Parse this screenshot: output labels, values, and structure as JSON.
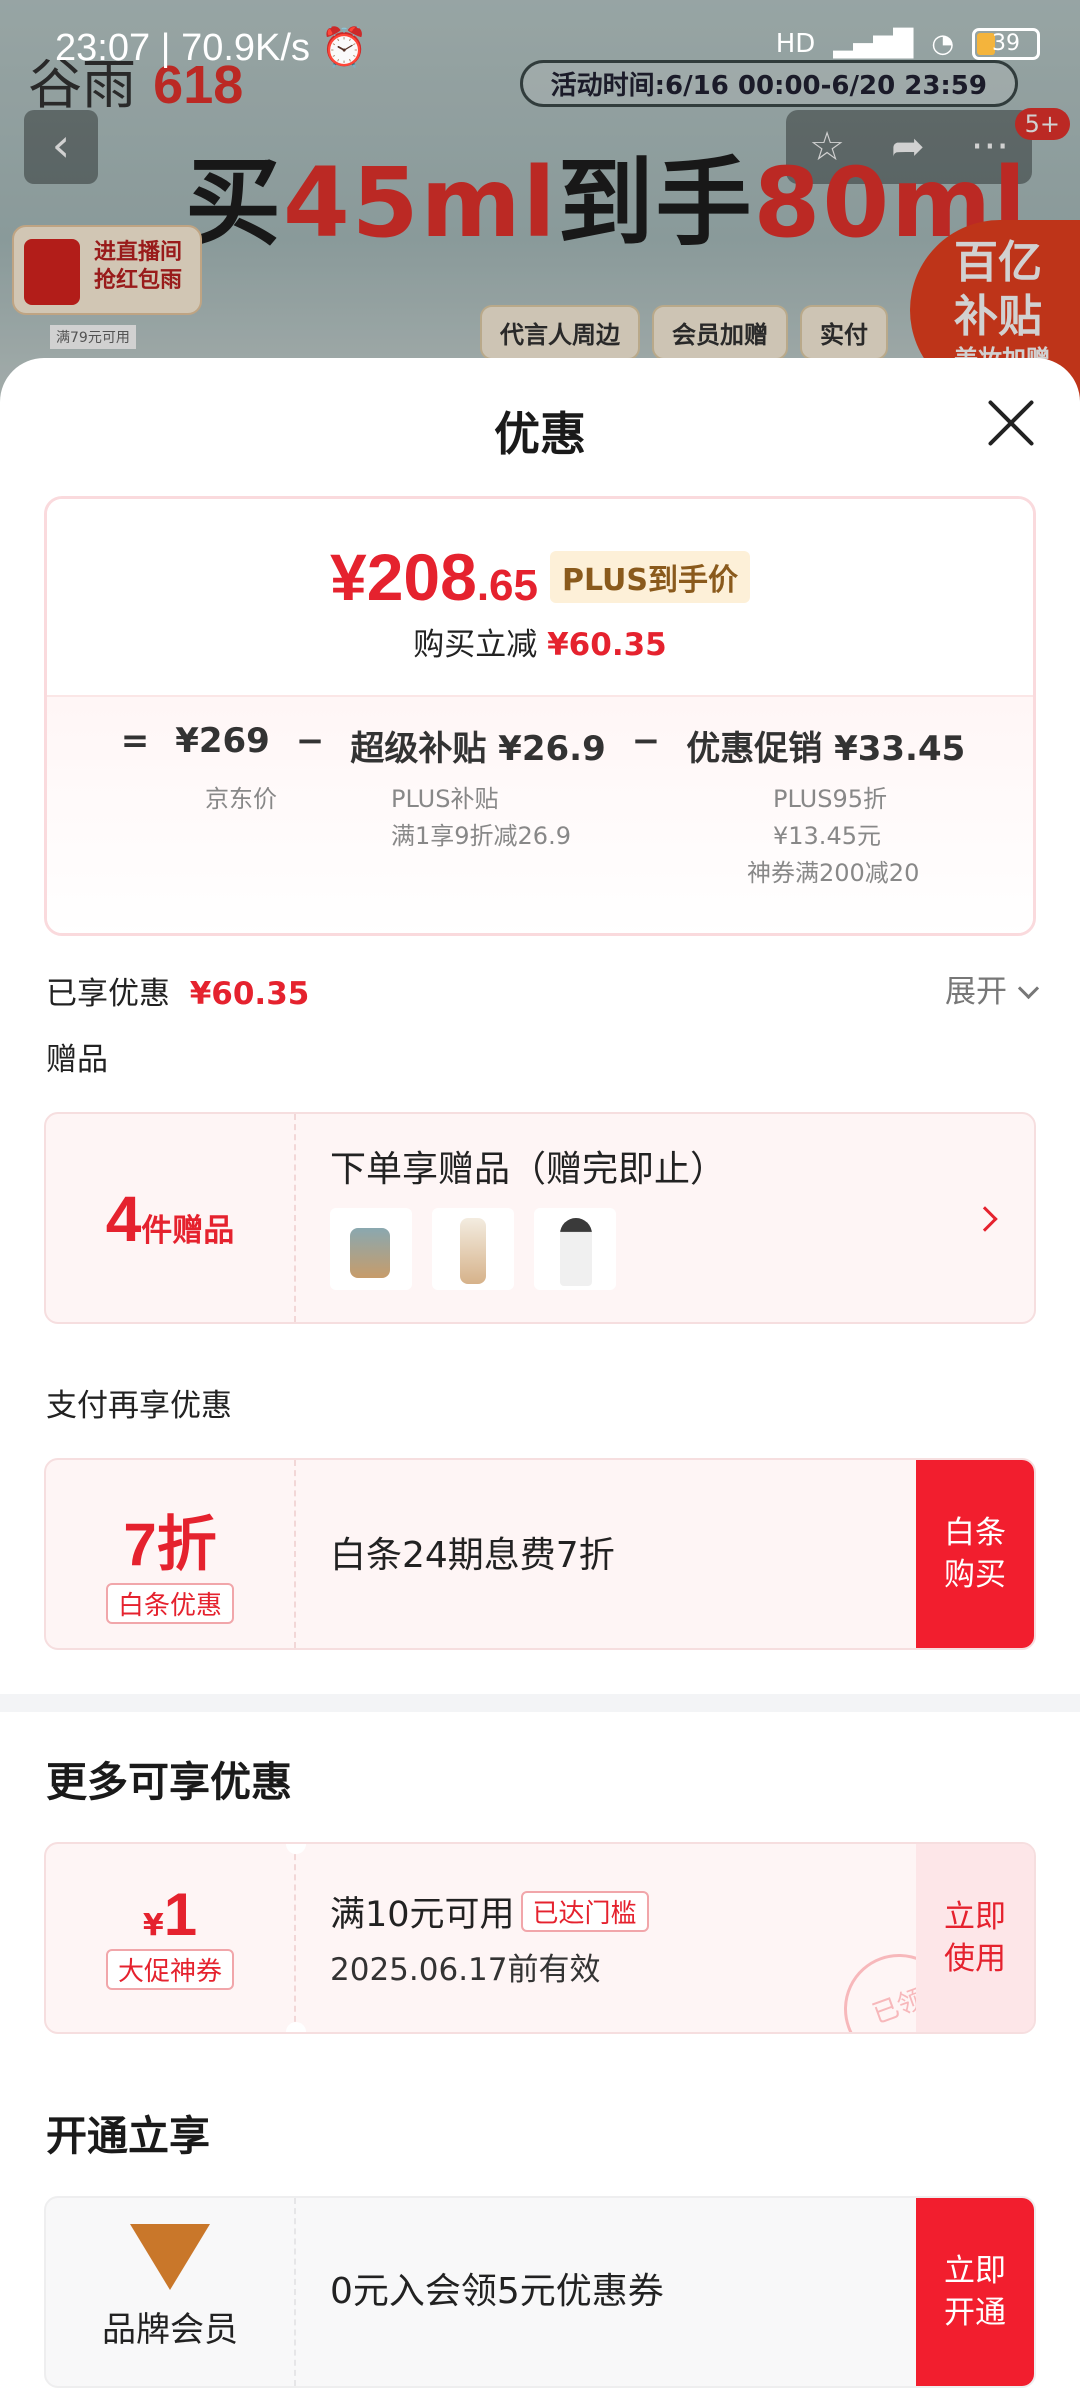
{
  "status_bar": {
    "time": "23:07 | 70.9K/s",
    "alarm_icon": "alarm-icon",
    "network": "HD",
    "battery": "39"
  },
  "background": {
    "brand": "谷雨",
    "brand_event": "618",
    "activity_time": "活动时间:6/16 00:00-6/20 23:59",
    "hero_prefix": "买",
    "hero_amount1": "45ml",
    "hero_middle": "到手",
    "hero_amount2": "80ml",
    "redpack_text": "进直播间 抢红包雨",
    "subsidy_text": "百亿 补贴",
    "subsidy_sub": "美妆加赠",
    "tabs": [
      "代言人周边",
      "会员加赠",
      "实付"
    ],
    "notification_count": "5+",
    "coupon_hint": "满79元可用"
  },
  "sheet": {
    "title": "优惠",
    "price": {
      "symbol": "¥",
      "integer": "208",
      "decimal": ".65",
      "tag": "PLUS到手价",
      "instant_label": "购买立减",
      "instant_value": "¥60.35",
      "eq": "=",
      "jd_price": "¥269",
      "minus1": "−",
      "subsidy_label": "超级补贴 ¥26.9",
      "minus2": "−",
      "promo_label": "优惠促销 ¥33.45",
      "jd_price_note": "京东价",
      "subsidy_note1": "PLUS补贴",
      "subsidy_note2": "满1享9折减26.9",
      "promo_note1": "PLUS95折",
      "promo_note2": "¥13.45元",
      "promo_note3": "神券满200减20"
    },
    "enjoyed": {
      "label": "已享优惠",
      "value": "¥60.35",
      "expand": "展开"
    },
    "gift": {
      "section": "赠品",
      "count": "4",
      "count_unit": "件赠品",
      "title": "下单享赠品（赠完即止）"
    },
    "pay": {
      "section": "支付再享优惠",
      "discount": "7",
      "discount_unit": "折",
      "tag": "白条优惠",
      "desc": "白条24期息费7折",
      "button": "白条\n购买"
    },
    "more": {
      "section": "更多可享优惠",
      "coupon_symbol": "¥",
      "coupon_value": "1",
      "coupon_tag": "大促神券",
      "coupon_title": "满10元可用",
      "coupon_badge": "已达门槛",
      "coupon_date": "2025.06.17前有效",
      "use_button": "立即\n使用",
      "stamp": "已领"
    },
    "member": {
      "section": "开通立享",
      "name": "品牌会员",
      "desc": "0元入会领5元优惠券",
      "button": "立即\n开通"
    }
  }
}
